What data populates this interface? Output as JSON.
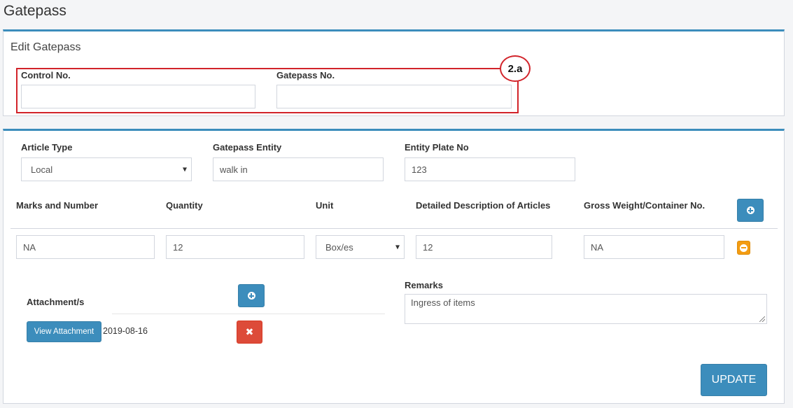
{
  "page": {
    "title": "Gatepass"
  },
  "edit_box": {
    "title": "Edit Gatepass",
    "control_no": {
      "label": "Control No.",
      "value": ""
    },
    "gatepass_no": {
      "label": "Gatepass No.",
      "value": ""
    },
    "annotation": {
      "label": "2.a",
      "color": "#d2232a"
    }
  },
  "details": {
    "article_type": {
      "label": "Article Type",
      "value": "Local"
    },
    "gatepass_entity": {
      "label": "Gatepass Entity",
      "value": "walk in"
    },
    "entity_plate_no": {
      "label": "Entity Plate No",
      "value": "123"
    }
  },
  "items_table": {
    "headers": {
      "marks": "Marks and Number",
      "quantity": "Quantity",
      "unit": "Unit",
      "description": "Detailed Description of Articles",
      "gross_weight": "Gross Weight/Container No."
    },
    "rows": [
      {
        "marks": "NA",
        "quantity": "12",
        "unit": "Box/es",
        "description": "12",
        "gross_weight": "NA"
      }
    ],
    "add_icon": "plus-circle-icon",
    "remove_icon": "minus-circle-icon"
  },
  "attachments": {
    "label": "Attachment/s",
    "items": [
      {
        "button_label": "View Attachment",
        "date": "2019-08-16"
      }
    ],
    "add_icon": "plus-circle-icon",
    "delete_icon": "times-icon"
  },
  "remarks": {
    "label": "Remarks",
    "value": "Ingress of items"
  },
  "actions": {
    "update_label": "UPDATE"
  },
  "colors": {
    "primary": "#3c8dbc",
    "danger": "#dd4b39",
    "warning": "#f39c12",
    "box_border_top": "#3c8dbc"
  }
}
